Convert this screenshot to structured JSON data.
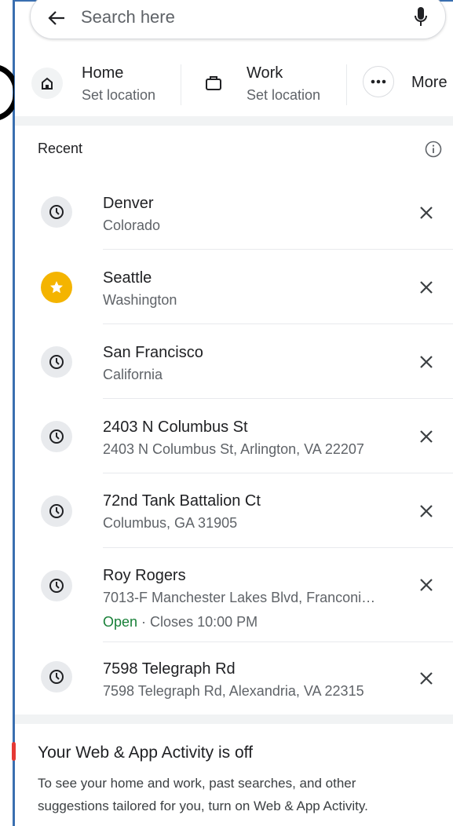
{
  "search": {
    "placeholder": "Search here"
  },
  "shortcuts": [
    {
      "title": "Home",
      "subtitle": "Set location",
      "icon": "home-icon"
    },
    {
      "title": "Work",
      "subtitle": "Set location",
      "icon": "briefcase-icon"
    },
    {
      "title": "More",
      "icon": "more-horiz-icon"
    }
  ],
  "recent": {
    "title": "Recent",
    "items": [
      {
        "name": "Denver",
        "address": "Colorado",
        "icon": "history-icon"
      },
      {
        "name": "Seattle",
        "address": "Washington",
        "icon": "star-icon"
      },
      {
        "name": "San Francisco",
        "address": "California",
        "icon": "history-icon"
      },
      {
        "name": "2403 N Columbus St",
        "address": "2403 N Columbus St, Arlington, VA 22207",
        "icon": "history-icon"
      },
      {
        "name": "72nd Tank Battalion Ct",
        "address": "Columbus, GA 31905",
        "icon": "history-icon"
      },
      {
        "name": "Roy Rogers",
        "address": "7013-F Manchester Lakes Blvd, Franconi…",
        "open": "Open",
        "hours": " · Closes 10:00 PM",
        "icon": "history-icon"
      },
      {
        "name": "7598 Telegraph Rd",
        "address": "7598 Telegraph Rd, Alexandria, VA 22315",
        "icon": "history-icon"
      }
    ]
  },
  "activity": {
    "title": "Your Web & App Activity is off",
    "body": "To see your home and work, past searches, and other suggestions tailored for you, turn on Web & App Activity."
  },
  "colors": {
    "star": "#f4b400",
    "open": "#188038",
    "frame": "#3a6fb0"
  }
}
